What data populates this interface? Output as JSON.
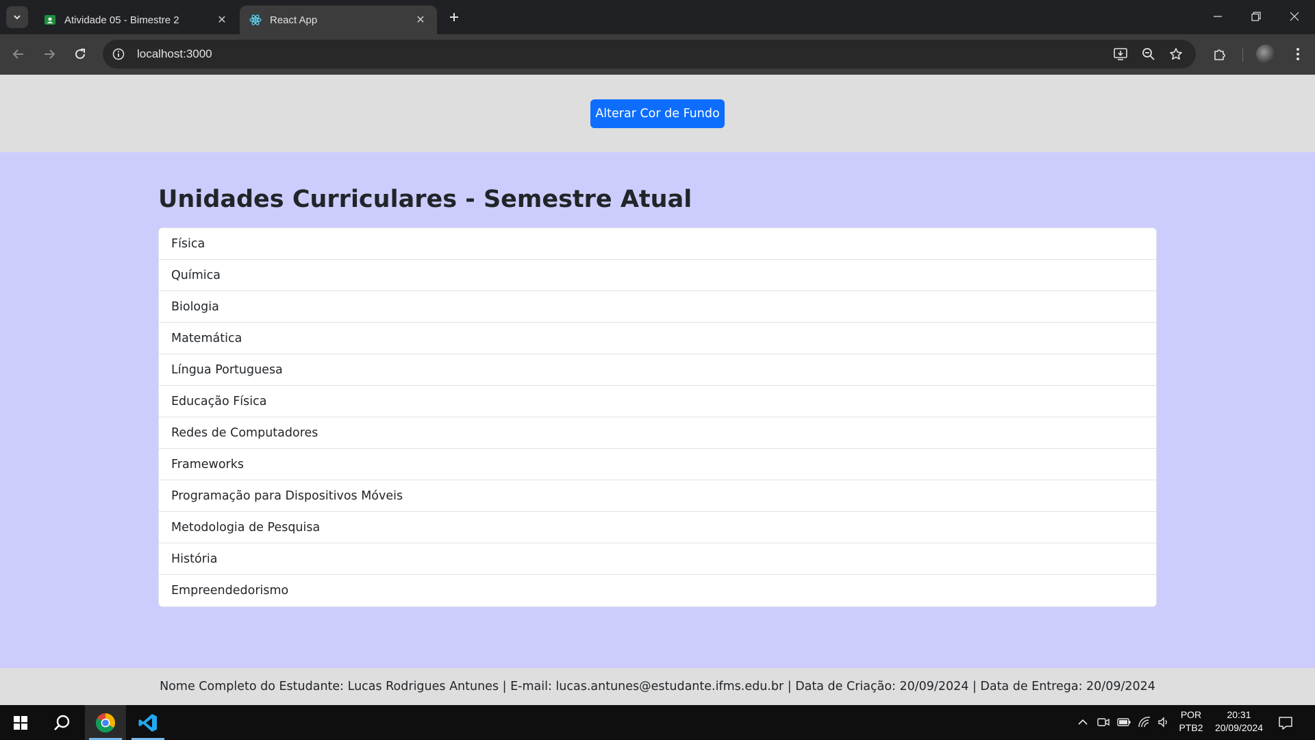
{
  "browser": {
    "tabs": [
      {
        "title": "Atividade 05 - Bimestre 2",
        "icon": "google-classroom-icon",
        "active": false
      },
      {
        "title": "React App",
        "icon": "react-icon",
        "active": true
      }
    ],
    "url": "localhost:3000"
  },
  "page": {
    "change_bg_button": "Alterar Cor de Fundo",
    "title": "Unidades Curriculares - Semestre Atual",
    "subjects": [
      "Física",
      "Química",
      "Biologia",
      "Matemática",
      "Língua Portuguesa",
      "Educação Física",
      "Redes de Computadores",
      "Frameworks",
      "Programação para Dispositivos Móveis",
      "Metodologia de Pesquisa",
      "História",
      "Empreendedorismo"
    ],
    "footer": "Nome Completo do Estudante: Lucas Rodrigues Antunes | E-mail: lucas.antunes@estudante.ifms.edu.br | Data de Criação: 20/09/2024 | Data de Entrega: 20/09/2024"
  },
  "taskbar": {
    "language_line1": "POR",
    "language_line2": "PTB2",
    "time": "20:31",
    "date": "20/09/2024"
  },
  "colors": {
    "page_background": "#cdcdfd",
    "band_background": "#dedede",
    "button_primary": "#0d6efd"
  }
}
